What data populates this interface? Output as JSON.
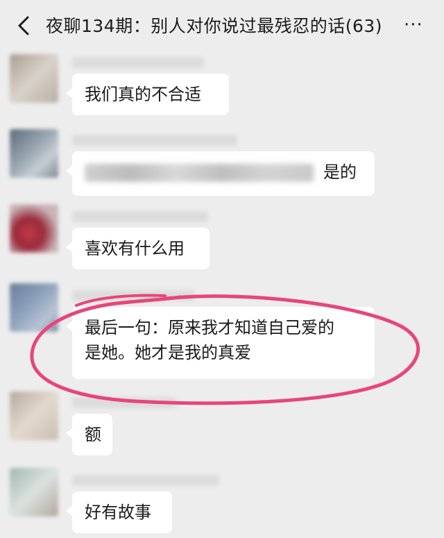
{
  "header": {
    "title": "夜聊134期：别人对你说过最残忍的话(63)",
    "back_icon": "chevron-left-icon",
    "more_icon": "more-horizontal-icon",
    "more_glyph": "···"
  },
  "messages": [
    {
      "text": "我们真的不合适"
    },
    {
      "text": "是的",
      "has_blurred_mention": true
    },
    {
      "text": "喜欢有什么用"
    },
    {
      "lines": [
        "最后一句：原来我才知道自己爱的",
        "是她。她才是我的真爱"
      ],
      "highlighted": true
    },
    {
      "text": "额"
    },
    {
      "text": "好有故事"
    }
  ],
  "colors": {
    "background": "#ededed",
    "bubble": "#ffffff",
    "highlight": "#e8457a"
  }
}
